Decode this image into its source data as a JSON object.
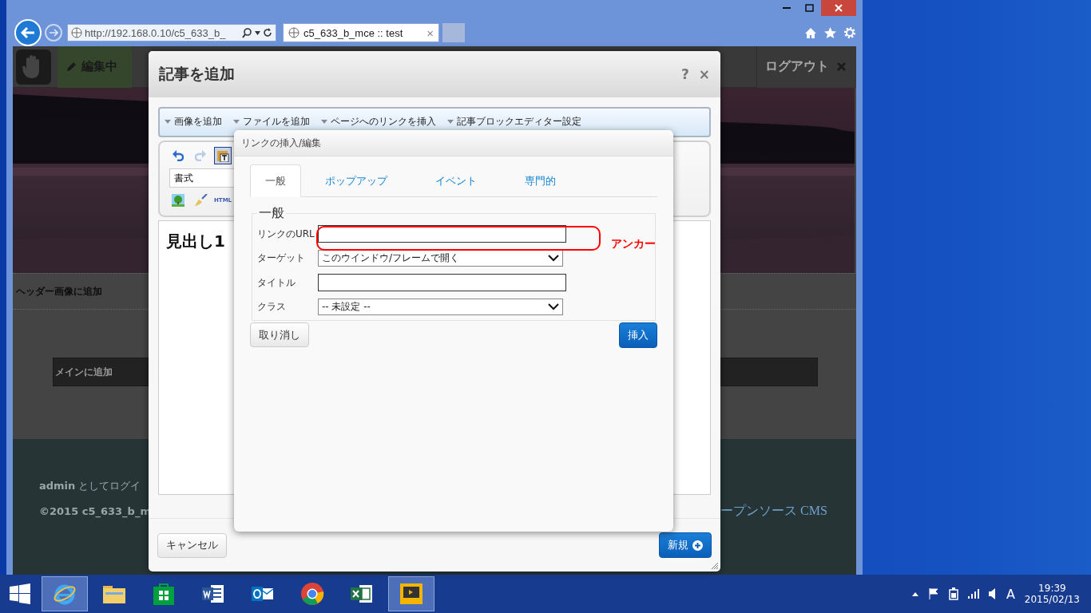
{
  "browser": {
    "address": "http://192.168.0.10/c5_633_b_",
    "tab": {
      "title": "c5_633_b_mce :: test",
      "close": "×"
    }
  },
  "page": {
    "edit_label": "編集中",
    "logout": "ログアウト",
    "header_area": "ヘッダー画像に追加",
    "main_area": "メインに追加",
    "footer_login": "**admin** としてログイ",
    "footer_copy": "©2015 c5_633_b_m",
    "footer_link": "ープンソース CMS"
  },
  "dialog": {
    "title": "記事を追加",
    "help": "?",
    "close": "×",
    "menus": [
      "画像を追加",
      "ファイルを追加",
      "ページへのリンクを挿入",
      "記事ブロックエディター設定"
    ],
    "format_select": "書式",
    "html_label": "HTML",
    "content_heading": "見出し1",
    "cancel": "キャンセル",
    "submit": "新規"
  },
  "link_dialog": {
    "title": "リンクの挿入/編集",
    "tabs": [
      {
        "label": "一般",
        "selected": true
      },
      {
        "label": "ポップアップ",
        "selected": false
      },
      {
        "label": "イベント",
        "selected": false
      },
      {
        "label": "専門的",
        "selected": false
      }
    ],
    "legend": "一般",
    "fields": [
      {
        "kind": "input",
        "label": "リンクのURL"
      },
      {
        "kind": "select",
        "label": "ターゲット",
        "value": "このウインドウ/フレームで開く"
      },
      {
        "kind": "input",
        "label": "タイトル"
      },
      {
        "kind": "select",
        "label": "クラス",
        "value": "-- 未設定 --"
      }
    ],
    "cancel": "取り消し",
    "insert": "挿入"
  },
  "annotation": {
    "label": "アンカー"
  },
  "taskbar": {
    "apps": [
      {
        "kind": "ie",
        "selected": true
      },
      {
        "kind": "folder",
        "selected": false
      },
      {
        "kind": "store",
        "selected": false
      },
      {
        "kind": "word",
        "selected": false
      },
      {
        "kind": "outlook",
        "selected": false
      },
      {
        "kind": "chrome",
        "selected": false
      },
      {
        "kind": "excel",
        "selected": false
      },
      {
        "kind": "video",
        "selected": true
      }
    ],
    "ime": "A",
    "time": "19:39",
    "date": "2015/02/13"
  }
}
